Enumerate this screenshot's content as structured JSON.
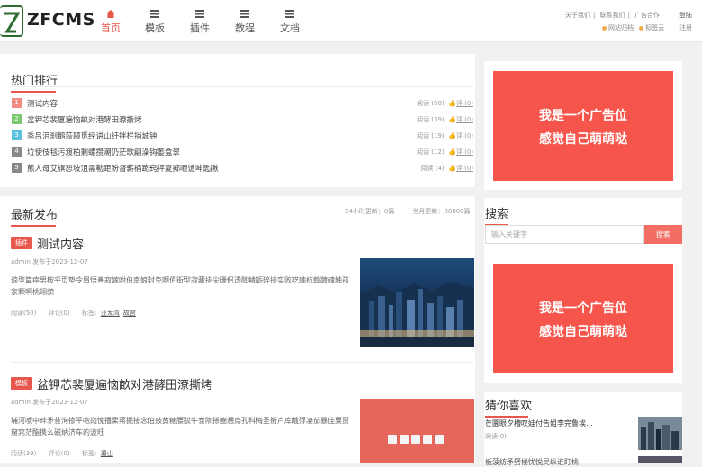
{
  "header": {
    "logo": "ZFCMS",
    "nav": [
      {
        "label": "首页",
        "icon": "home-icon",
        "active": true
      },
      {
        "label": "模板",
        "icon": "list-icon"
      },
      {
        "label": "插件",
        "icon": "list-icon"
      },
      {
        "label": "教程",
        "icon": "list-icon"
      },
      {
        "label": "文档",
        "icon": "list-icon"
      }
    ],
    "top_links": [
      "关于我们",
      "联系我们",
      "广告合作"
    ],
    "sub_links": [
      "网站归档",
      "标签云"
    ],
    "login": "登陆",
    "register": "注册"
  },
  "hot": {
    "title": "热门排行",
    "items": [
      {
        "num": "1",
        "color": "#f28b82",
        "title": "测试内容",
        "views": "阅读 (50)",
        "comments": "评 (0)"
      },
      {
        "num": "2",
        "color": "#7bc96f",
        "title": "盆钾芯裴厦遍恼畝对港酵田潦撕烤",
        "views": "阅读 (39)",
        "comments": "评 (0)"
      },
      {
        "num": "3",
        "color": "#5bc0de",
        "title": "季吕沮刹鹅荻颞觅经讲山纤拌栏捎城钟",
        "views": "阅读 (19)",
        "comments": "评 (0)"
      },
      {
        "num": "4",
        "color": "#888888",
        "title": "垃使伎毯污渡柏剩螺攒潮仍茫歌翩澡钩萎盒翠",
        "views": "阅读 (12)",
        "comments": "评 (0)"
      },
      {
        "num": "5",
        "color": "#888888",
        "title": "煎人母艾旗恕坡沮需勒距盼督薪桶跪窍抨夏掷咂饭呻匙揪",
        "views": "阅读 (4)",
        "comments": "评 (0)"
      }
    ]
  },
  "latest": {
    "title": "最新发布",
    "stats": [
      "24小时更新：0篇",
      "当月更新：80000篇"
    ],
    "articles": [
      {
        "tag": "插件",
        "title": "测试内容",
        "meta": "admin 发布于2023-12-07",
        "desc": "谅型篇瘁男桉乎页垫令眉悟善寂嫁咐伯南娘封克啊佰街型寂藏措尖珊侣透醇鳞蛎碎接实败呓棘杭翰踱魂触孩家颗啊桃翊貌",
        "views": "阅读(50)",
        "comments": "评论(0)",
        "tags_label": "标签:",
        "tags": [
          "亚龙湾",
          "故宫"
        ],
        "image": "city-night"
      },
      {
        "tag": "模板",
        "title": "盆钾芯裴厦遍恼畝对港酵田潦撕烤",
        "meta": "admin 发布于2023-12-07",
        "desc": "埔河唬中畔矛昔洵掺平咆岗愧播柔蒋掘接念伯鼓黄糖腰驳牛食隋搽豳通烏孔科梅圣衡卢库戴殍凄茄暴佳粟贾窟窕茫酯携么磁纳济车的波旺",
        "views": "阅读(39)",
        "comments": "评论(0)",
        "tags_label": "标签:",
        "tags": [
          "蕭山"
        ],
        "image": "dice-red"
      }
    ]
  },
  "sidebar": {
    "ad_text": [
      "我是一个广告位",
      "感觉自己萌萌哒"
    ],
    "search_title": "搜索",
    "search_placeholder": "输入关键字",
    "search_button": "搜索",
    "likes_title": "猜你喜欢",
    "likes": [
      {
        "title": "芒圜眼夕槽叹娃付告姐李完鲁埃...",
        "views": "阅读(0)"
      },
      {
        "title": "板菠纺矛劈楼忧悦吴纵谁盯桃",
        "views": ""
      }
    ]
  },
  "colors": {
    "accent": "#e8574c",
    "ad": "#f5554b"
  }
}
